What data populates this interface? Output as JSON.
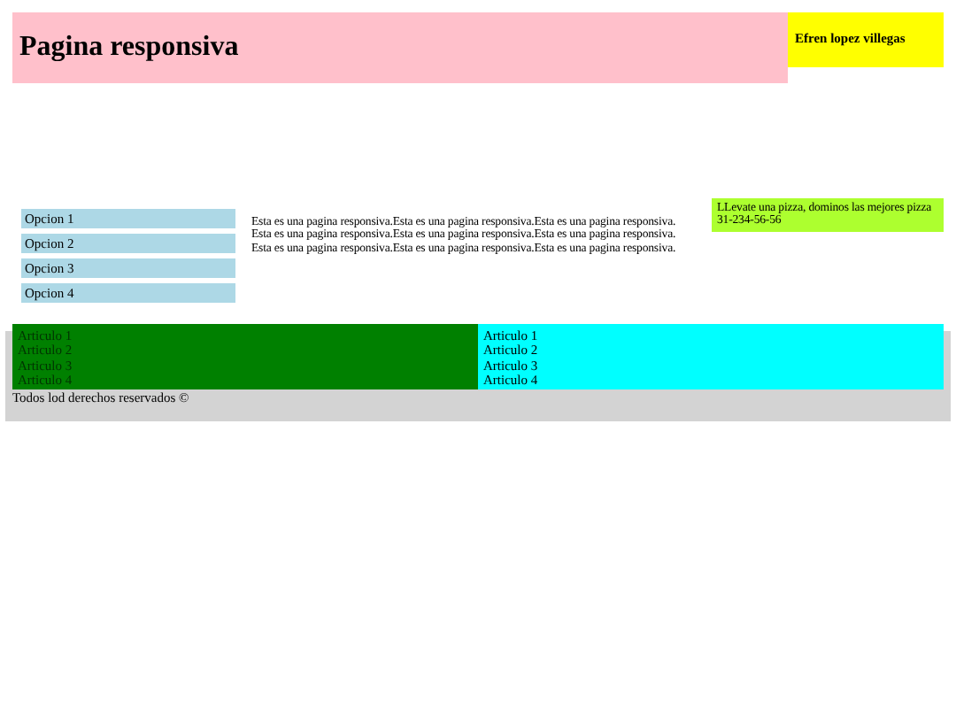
{
  "header": {
    "title": "Pagina responsiva",
    "author": "Efren lopez villegas"
  },
  "menu": [
    "Opcion 1",
    "Opcion 2",
    "Opcion 3",
    "Opcion 4"
  ],
  "main": {
    "lines": [
      "Esta es una pagina responsiva.Esta es una pagina responsiva.Esta es una pagina responsiva.",
      "Esta es una pagina responsiva.Esta es una pagina responsiva.Esta es una pagina responsiva.",
      "Esta es una pagina responsiva.Esta es una pagina responsiva.Esta es una pagina responsiva."
    ]
  },
  "aside": {
    "text": "LLevate una pizza, dominos las mejores pizza",
    "phone": "31-234-56-56"
  },
  "articles": [
    {
      "color": "#008000",
      "items": [
        "Articulo 1",
        "Articulo 2",
        "Articulo 3",
        "Articulo 4"
      ]
    },
    {
      "color": "#00ffff",
      "items": [
        "Articulo 1",
        "Articulo 2",
        "Articulo 3",
        "Articulo 4"
      ]
    }
  ],
  "footer": {
    "text": "Todos lod derechos reservados ©"
  }
}
